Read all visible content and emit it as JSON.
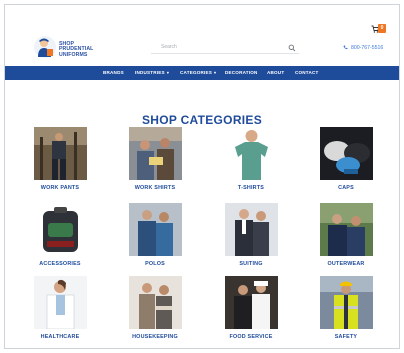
{
  "brand": {
    "lines": [
      "Shop",
      "Prudential",
      "Uniforms"
    ]
  },
  "search": {
    "placeholder": "Search"
  },
  "cart": {
    "count": "0"
  },
  "phone": "800-767-5516",
  "nav": {
    "items": [
      {
        "label": "BRANDS",
        "caret": ""
      },
      {
        "label": "INDUSTRIES",
        "caret": "▾"
      },
      {
        "label": "CATEGORIES",
        "caret": "▾"
      },
      {
        "label": "DECORATION",
        "caret": ""
      },
      {
        "label": "ABOUT",
        "caret": ""
      },
      {
        "label": "CONTACT",
        "caret": ""
      }
    ]
  },
  "title": "SHOP CATEGORIES",
  "categories": [
    {
      "label": "WORK PANTS"
    },
    {
      "label": "WORK SHIRTS"
    },
    {
      "label": "T-SHIRTS"
    },
    {
      "label": "CAPS"
    },
    {
      "label": "ACCESSORIES"
    },
    {
      "label": "POLOS"
    },
    {
      "label": "SUITING"
    },
    {
      "label": "OUTERWEAR"
    },
    {
      "label": "HEALTHCARE"
    },
    {
      "label": "HOUSEKEEPING"
    },
    {
      "label": "FOOD SERVICE"
    },
    {
      "label": "SAFETY"
    }
  ],
  "colors": {
    "accent": "#1f4b9b",
    "badge": "#f07623",
    "phone": "#3d7bd8"
  }
}
